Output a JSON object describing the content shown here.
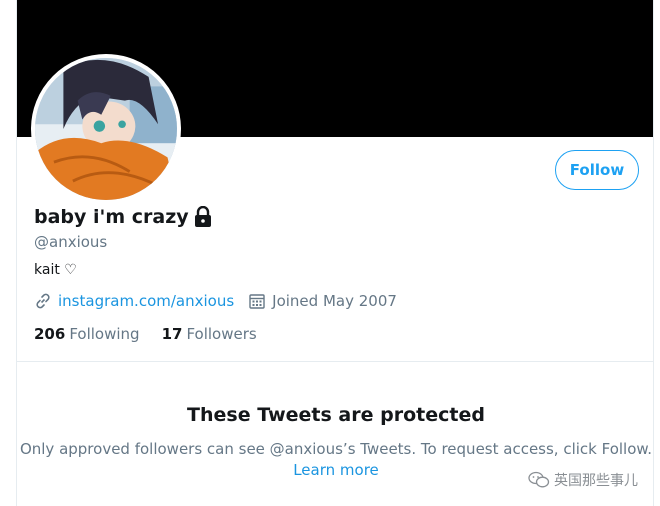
{
  "profile": {
    "display_name": "baby i'm crazy",
    "handle": "@anxious",
    "bio": "kait ♡",
    "website": "instagram.com/anxious",
    "joined": "Joined May 2007",
    "following_count": "206",
    "following_label": "Following",
    "followers_count": "17",
    "followers_label": "Followers"
  },
  "actions": {
    "follow_label": "Follow"
  },
  "protected": {
    "title": "These Tweets are protected",
    "description": "Only approved followers can see @anxious’s Tweets. To request access, click Follow.",
    "learn_more": "Learn more"
  },
  "watermark": {
    "text": "英国那些事儿"
  },
  "colors": {
    "accent": "#1da1f2",
    "link": "#1b95e0",
    "muted": "#657786",
    "banner": "#000000"
  },
  "icons": [
    "lock-icon",
    "link-icon",
    "calendar-icon",
    "wechat-icon"
  ]
}
